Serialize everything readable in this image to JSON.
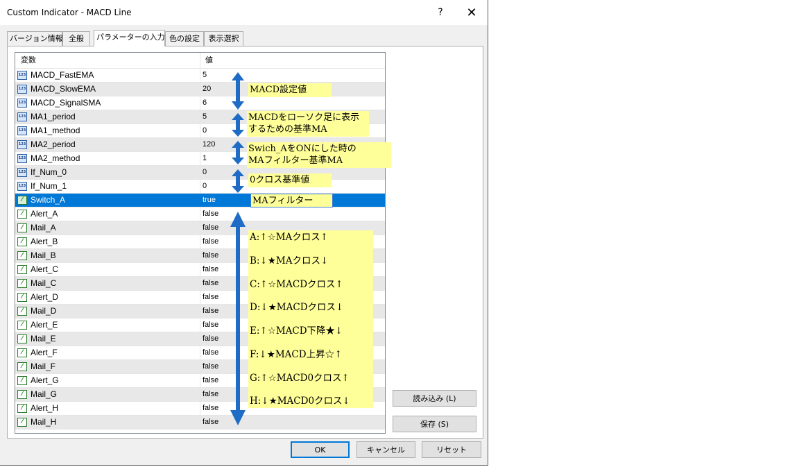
{
  "window": {
    "title": "Custom Indicator - MACD Line",
    "help_label": "?",
    "close_label": "✕"
  },
  "tabs": [
    {
      "label": "バージョン情報",
      "active": false
    },
    {
      "label": "全般",
      "active": false
    },
    {
      "label": "パラメーターの入力",
      "active": true
    },
    {
      "label": "色の設定",
      "active": false
    },
    {
      "label": "表示選択",
      "active": false
    }
  ],
  "grid": {
    "headers": {
      "variable": "変数",
      "value": "値"
    },
    "rows": [
      {
        "name": "MACD_FastEMA",
        "value": "5",
        "type": "int"
      },
      {
        "name": "MACD_SlowEMA",
        "value": "20",
        "type": "int"
      },
      {
        "name": "MACD_SignalSMA",
        "value": "6",
        "type": "int"
      },
      {
        "name": "MA1_period",
        "value": "5",
        "type": "int"
      },
      {
        "name": "MA1_method",
        "value": "0",
        "type": "int"
      },
      {
        "name": "MA2_period",
        "value": "120",
        "type": "int"
      },
      {
        "name": "MA2_method",
        "value": "1",
        "type": "int"
      },
      {
        "name": "If_Num_0",
        "value": "0",
        "type": "int"
      },
      {
        "name": "If_Num_1",
        "value": "0",
        "type": "int"
      },
      {
        "name": "Switch_A",
        "value": "true",
        "type": "bool",
        "selected": true
      },
      {
        "name": "Alert_A",
        "value": "false",
        "type": "bool"
      },
      {
        "name": "Mail_A",
        "value": "false",
        "type": "bool"
      },
      {
        "name": "Alert_B",
        "value": "false",
        "type": "bool"
      },
      {
        "name": "Mail_B",
        "value": "false",
        "type": "bool"
      },
      {
        "name": "Alert_C",
        "value": "false",
        "type": "bool"
      },
      {
        "name": "Mail_C",
        "value": "false",
        "type": "bool"
      },
      {
        "name": "Alert_D",
        "value": "false",
        "type": "bool"
      },
      {
        "name": "Mail_D",
        "value": "false",
        "type": "bool"
      },
      {
        "name": "Alert_E",
        "value": "false",
        "type": "bool"
      },
      {
        "name": "Mail_E",
        "value": "false",
        "type": "bool"
      },
      {
        "name": "Alert_F",
        "value": "false",
        "type": "bool"
      },
      {
        "name": "Mail_F",
        "value": "false",
        "type": "bool"
      },
      {
        "name": "Alert_G",
        "value": "false",
        "type": "bool"
      },
      {
        "name": "Mail_G",
        "value": "false",
        "type": "bool"
      },
      {
        "name": "Alert_H",
        "value": "false",
        "type": "bool"
      },
      {
        "name": "Mail_H",
        "value": "false",
        "type": "bool"
      }
    ]
  },
  "annotations": {
    "macd_settings": "MACD設定値",
    "ma1": [
      "MACDをローソク足に表示",
      "するための基準MA"
    ],
    "ma2": [
      "Swich_AをONにした時の",
      "MAフィルター基準MA"
    ],
    "zero_cross": "0クロス基準値",
    "ma_filter": "MAフィルター",
    "alerts": [
      "A:↑☆MAクロス↑",
      "B:↓★MAクロス↓",
      "C:↑☆MACDクロス↑",
      "D:↓★MACDクロス↓",
      "E:↑☆MACD下降★↓",
      "F:↓★MACD上昇☆↑",
      "G:↑☆MACD0クロス↑",
      "H:↓★MACD0クロス↓"
    ]
  },
  "buttons": {
    "load": "読み込み (L)",
    "save": "保存 (S)",
    "ok": "OK",
    "cancel": "キャンセル",
    "reset": "リセット"
  },
  "icons": {
    "int_type": "123",
    "bool_type": "⁄"
  },
  "colors": {
    "selection": "#0078d7",
    "annotation_bg": "#ffff99",
    "arrow": "#1f6cc6"
  }
}
